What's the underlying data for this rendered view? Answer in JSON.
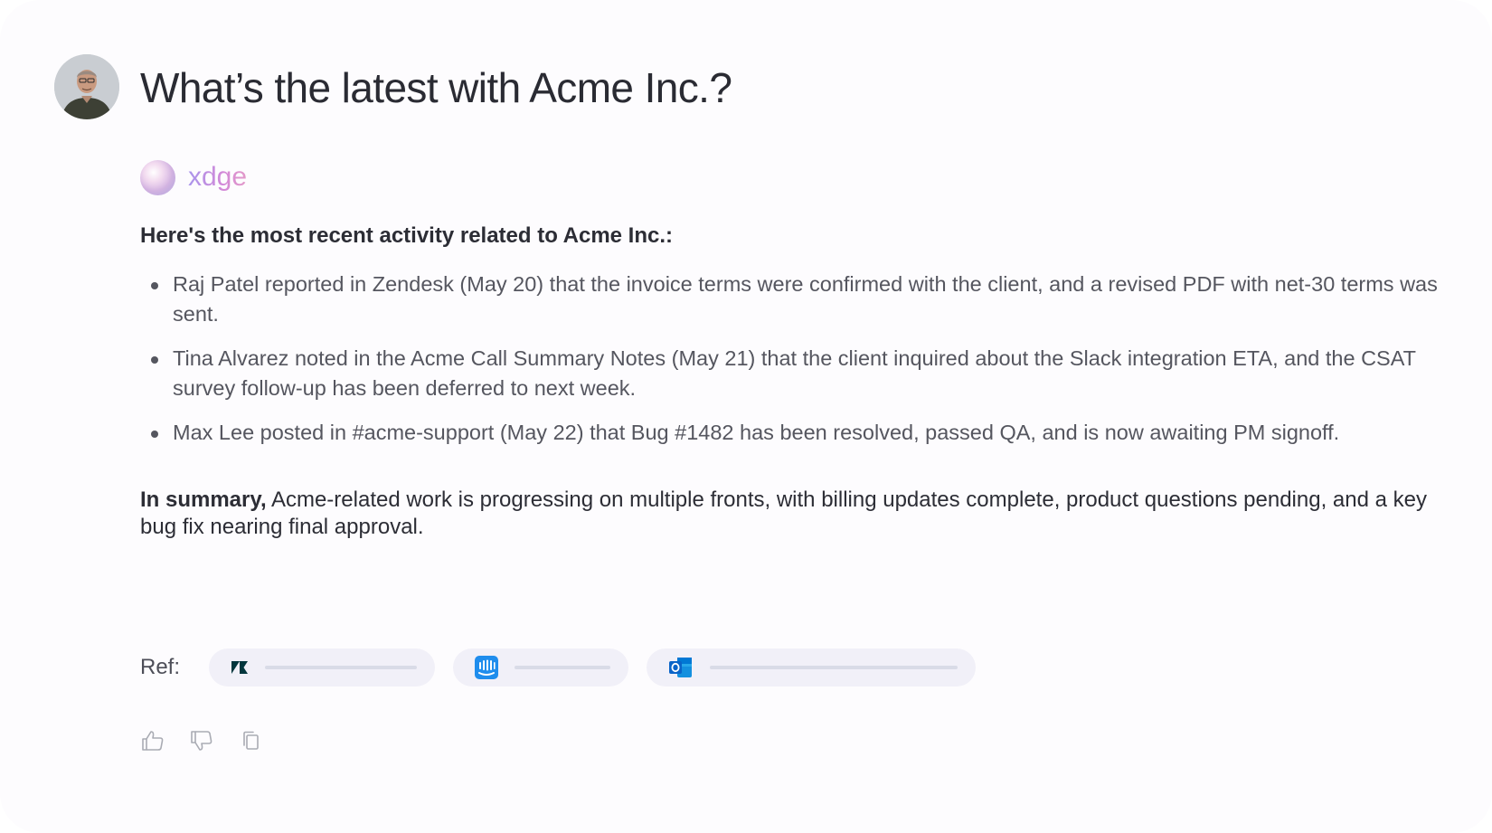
{
  "question": "What’s the latest with Acme Inc.?",
  "assistant": {
    "name": "xdge"
  },
  "response": {
    "intro": "Here's the most recent activity related to Acme Inc.:",
    "bullets": [
      "Raj Patel reported in Zendesk (May 20) that the invoice terms were confirmed with the client, and a revised PDF with net-30 terms was sent.",
      "Tina Alvarez noted in the Acme Call Summary Notes (May 21) that the client inquired about the Slack integration ETA, and the CSAT survey follow-up has been deferred to next week.",
      "Max Lee posted in #acme-support (May 22) that Bug #1482 has been resolved, passed QA, and is now awaiting PM signoff."
    ],
    "summary_lead": "In summary,",
    "summary_text": " Acme-related work is progressing on multiple fronts, with billing updates complete, product questions pending, and a key bug fix nearing final approval."
  },
  "references": {
    "label": "Ref:",
    "items": [
      {
        "icon": "zendesk-icon",
        "color": "#03363d"
      },
      {
        "icon": "intercom-icon",
        "color": "#1f8ded"
      },
      {
        "icon": "outlook-icon",
        "color": "#0a64c8"
      }
    ]
  },
  "actions": [
    {
      "icon": "thumbs-up-icon"
    },
    {
      "icon": "thumbs-down-icon"
    },
    {
      "icon": "copy-icon"
    }
  ],
  "colors": {
    "background": "#fdfcfe",
    "question_text": "#2a2b33",
    "body_text": "#55565f",
    "assistant_gradient_start": "#a995ec",
    "assistant_gradient_end": "#e39ac9",
    "chip_background": "#f1f0f8",
    "icon_gray": "#a9abb3"
  }
}
